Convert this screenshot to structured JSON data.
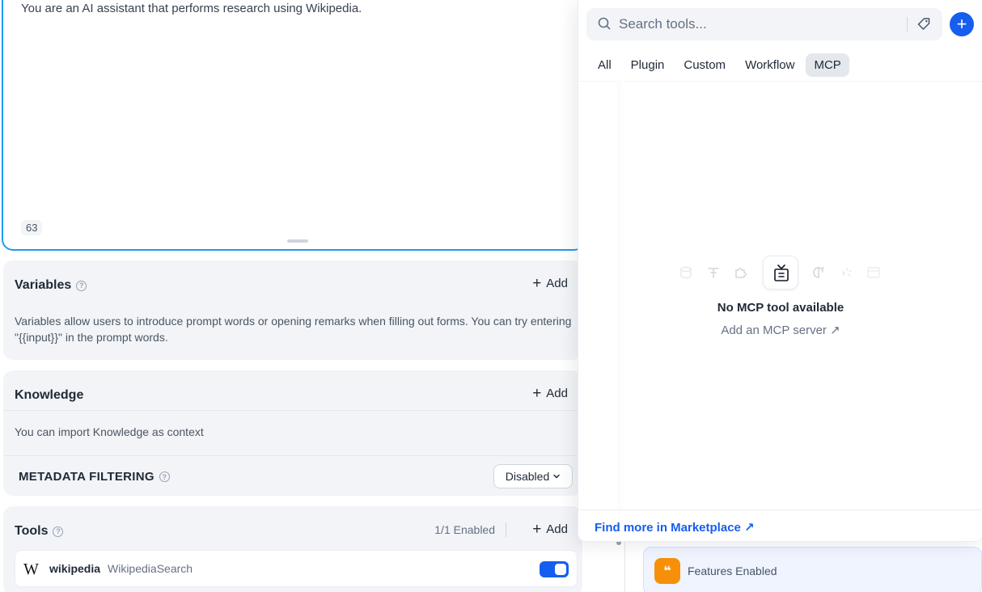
{
  "prompt": {
    "text": "You are an AI assistant that performs research using Wikipedia.",
    "char_count": "63"
  },
  "variables": {
    "title": "Variables",
    "add_label": "Add",
    "description": "Variables allow users to introduce prompt words or opening remarks when filling out forms. You can try entering \"{{input}}\" in the prompt words."
  },
  "knowledge": {
    "title": "Knowledge",
    "add_label": "Add",
    "description": "You can import Knowledge as context",
    "metadata_title": "METADATA FILTERING",
    "metadata_value": "Disabled"
  },
  "tools": {
    "title": "Tools",
    "enabled_count": "1/1 Enabled",
    "add_label": "Add",
    "items": [
      {
        "name": "wikipedia",
        "subtitle": "WikipediaSearch",
        "icon": "W",
        "enabled": true
      }
    ]
  },
  "features": {
    "label": "Features Enabled",
    "icon": "quote-icon"
  },
  "popup": {
    "search_placeholder": "Search tools...",
    "tabs": [
      "All",
      "Plugin",
      "Custom",
      "Workflow",
      "MCP"
    ],
    "active_tab": "MCP",
    "empty_title": "No MCP tool available",
    "empty_link": "Add an MCP server ↗",
    "marketplace_link": "Find more in Marketplace ↗"
  },
  "colors": {
    "accent": "#155eef",
    "prompt_border": "#1d9bf0",
    "features_icon": "#f79009"
  }
}
